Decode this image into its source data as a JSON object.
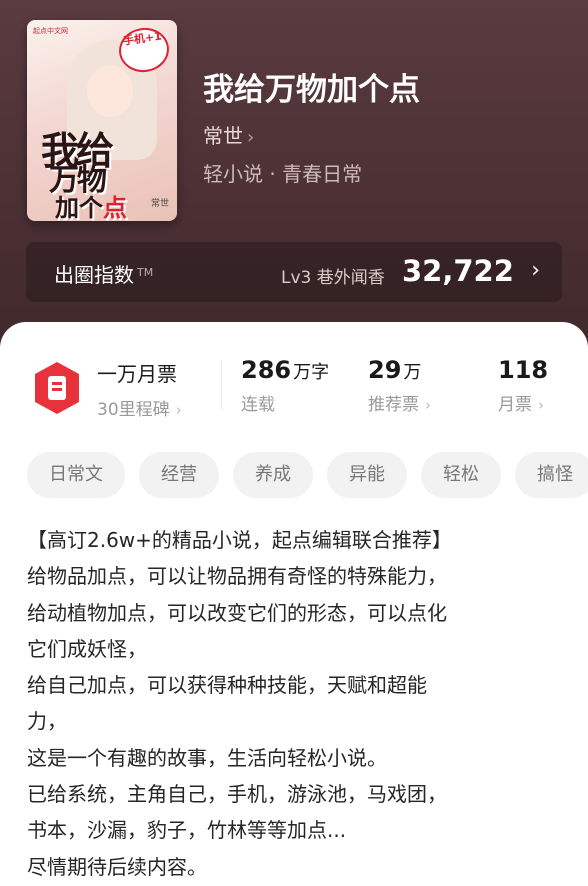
{
  "book": {
    "title": "我给万物加个点",
    "author": "常世",
    "genre": "轻小说 · 青春日常",
    "cover": {
      "publisher": "起点中文网",
      "stamp": "手机+1",
      "title_lines": [
        "我给",
        "万物",
        "加个"
      ],
      "title_accent": "点",
      "author": "常世"
    }
  },
  "influence": {
    "label": "出圈指数",
    "tm": "TM",
    "level_text": "Lv3 巷外闻香",
    "value": "32,722"
  },
  "stats": {
    "badge_title": "一万月票",
    "badge_sub": "30里程碑",
    "words_num": "286",
    "words_unit": "万字",
    "words_label": "连载",
    "rec_num": "29",
    "rec_unit": "万",
    "rec_label": "推荐票",
    "monthly_num": "118",
    "monthly_label": "月票"
  },
  "tags": [
    "日常文",
    "经营",
    "养成",
    "异能",
    "轻松",
    "搞怪"
  ],
  "intro": "【高订2.6w+的精品小说，起点编辑联合推荐】\n给物品加点，可以让物品拥有奇怪的特殊能力，\n给动植物加点，可以改变它们的形态，可以点化\n它们成妖怪，\n给自己加点，可以获得种种技能，天赋和超能\n力，\n这是一个有趣的故事，生活向轻松小说。\n已给系统，主角自己，手机，游泳池，马戏团，\n书本，沙漏，豹子，竹林等等加点...\n尽情期待后续内容。",
  "colors": {
    "hero_bg": "#4b3034",
    "accent_red": "#e8323b"
  }
}
